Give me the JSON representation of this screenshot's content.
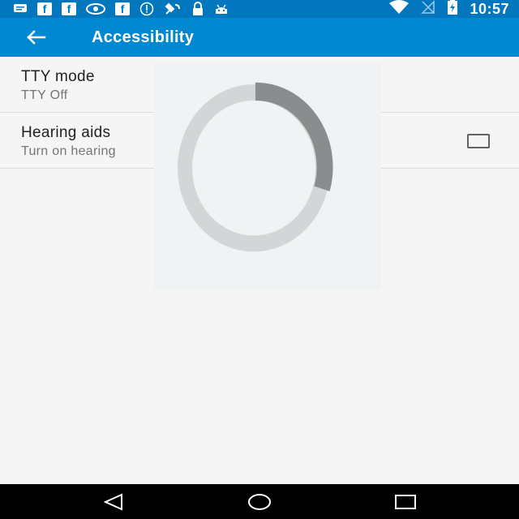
{
  "status_bar": {
    "time": "10:57",
    "notification_icons": [
      "message-icon",
      "facebook-icon",
      "facebook-icon",
      "eye-icon",
      "facebook-icon",
      "info-icon",
      "satellite-icon",
      "lock-icon",
      "android-icon"
    ],
    "system_icons": [
      "wifi-icon",
      "no-signal-icon",
      "battery-charging-icon"
    ],
    "fb_glyph": "f"
  },
  "app_bar": {
    "title": "Accessibility",
    "back_icon": "arrow-back-icon",
    "color": "#0288d1"
  },
  "settings": [
    {
      "title": "TTY mode",
      "summary": "TTY Off",
      "has_checkbox": false
    },
    {
      "title": "Hearing aids",
      "summary": "Turn on hearing",
      "has_checkbox": true,
      "checked": false
    }
  ],
  "loading": {
    "icon": "loading-spinner-icon",
    "progress_fraction": 0.3
  },
  "nav_bar": {
    "buttons": [
      "back-triangle-icon",
      "home-circle-icon",
      "recents-square-icon"
    ]
  }
}
